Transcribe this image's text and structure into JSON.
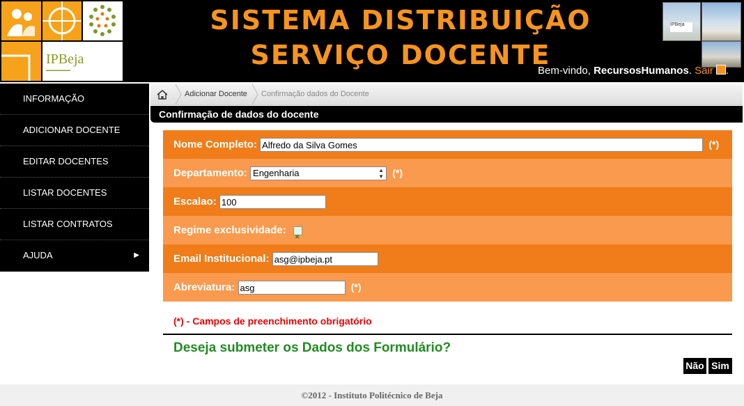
{
  "header": {
    "title_line1": "SISTEMA DISTRIBUIÇÃO",
    "title_line2": "SERVIÇO DOCENTE",
    "logo_text": "IPBeja",
    "welcome_prefix": "Bem-vindo, ",
    "username": "RecursosHumanos",
    "welcome_sep": ". ",
    "logout_label": "Sair",
    "welcome_suffix": ".",
    "photo_label": "IPBeja"
  },
  "sidebar": {
    "items": [
      {
        "label": "INFORMAÇÃO"
      },
      {
        "label": "ADICIONAR DOCENTE"
      },
      {
        "label": "EDITAR DOCENTES"
      },
      {
        "label": "LISTAR DOCENTES"
      },
      {
        "label": "LISTAR CONTRATOS"
      },
      {
        "label": "AJUDA",
        "chevron": "▶"
      }
    ]
  },
  "breadcrumb": {
    "home_icon": "home-icon",
    "items": [
      "Adicionar Docente",
      "Confirmação dados do Docente"
    ]
  },
  "section_title": "Confirmação de dados do docente",
  "form": {
    "nome": {
      "label": "Nome Completo:",
      "value": "Alfredo da Silva Gomes",
      "required": "(*)"
    },
    "departamento": {
      "label": "Departamento:",
      "value": "Engenharia",
      "required": "(*)"
    },
    "escalao": {
      "label": "Escalao:",
      "value": "100"
    },
    "regime": {
      "label": "Regime exclusividade:",
      "checked": true
    },
    "email": {
      "label": "Email Institucional:",
      "value": "asg@ipbeja.pt"
    },
    "abreviatura": {
      "label": "Abreviatura:",
      "value": "asg",
      "required": "(*)"
    }
  },
  "note": "(*) - Campos de preenchimento obrigatório",
  "question": "Deseja submeter os Dados dos Formulário?",
  "buttons": {
    "no": "Não",
    "yes": "Sim"
  },
  "footer": "©2012 - Instituto Politécnico de Beja",
  "colors": {
    "accent": "#f7941d",
    "row_dark": "#f07d1a",
    "row_light": "#fa9a4e",
    "required_note": "#e00000",
    "question": "#228b22"
  }
}
